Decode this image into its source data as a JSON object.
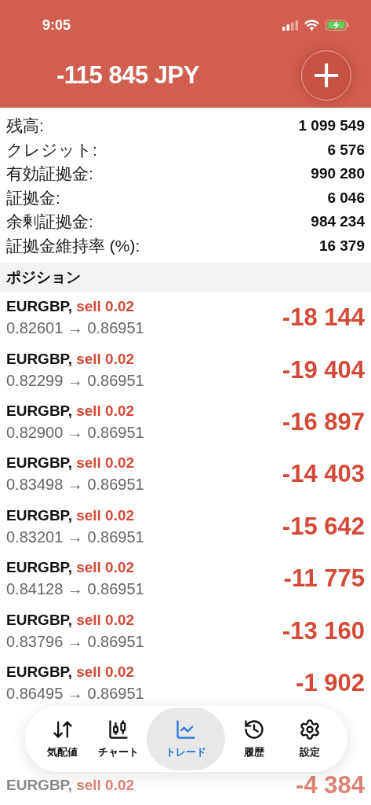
{
  "status_bar": {
    "time": "9:05"
  },
  "header": {
    "balance": "-115 845 JPY",
    "add_button": "+"
  },
  "account": [
    {
      "label": "残高:",
      "value": "1 099 549"
    },
    {
      "label": "クレジット:",
      "value": "6 576"
    },
    {
      "label": "有効証拠金:",
      "value": "990 280"
    },
    {
      "label": "証拠金:",
      "value": "6 046"
    },
    {
      "label": "余剰証拠金:",
      "value": "984 234"
    },
    {
      "label": "証拠金維持率 (%):",
      "value": "16 379"
    }
  ],
  "section_title": "ポジション",
  "positions": [
    {
      "symbol": "EURGBP,",
      "side": "sell 0.02",
      "prices": "0.82601 → 0.86951",
      "profit": "-18 144"
    },
    {
      "symbol": "EURGBP,",
      "side": "sell 0.02",
      "prices": "0.82299 → 0.86951",
      "profit": "-19 404"
    },
    {
      "symbol": "EURGBP,",
      "side": "sell 0.02",
      "prices": "0.82900 → 0.86951",
      "profit": "-16 897"
    },
    {
      "symbol": "EURGBP,",
      "side": "sell 0.02",
      "prices": "0.83498 → 0.86951",
      "profit": "-14 403"
    },
    {
      "symbol": "EURGBP,",
      "side": "sell 0.02",
      "prices": "0.83201 → 0.86951",
      "profit": "-15 642"
    },
    {
      "symbol": "EURGBP,",
      "side": "sell 0.02",
      "prices": "0.84128 → 0.86951",
      "profit": "-11 775"
    },
    {
      "symbol": "EURGBP,",
      "side": "sell 0.02",
      "prices": "0.83796 → 0.86951",
      "profit": "-13 160"
    },
    {
      "symbol": "EURGBP,",
      "side": "sell 0.02",
      "prices": "0.86495 → 0.86951",
      "profit": "-1 902"
    }
  ],
  "faded_position": {
    "symbol": "EURGBP,",
    "side": "sell 0.02",
    "profit": "-4 384"
  },
  "tabs": [
    {
      "kind": "quotes",
      "label": "気配値",
      "selected": false
    },
    {
      "kind": "chart",
      "label": "チャート",
      "selected": false
    },
    {
      "kind": "trade",
      "label": "トレード",
      "selected": true
    },
    {
      "kind": "history",
      "label": "履歴",
      "selected": false
    },
    {
      "kind": "settings",
      "label": "設定",
      "selected": false
    }
  ]
}
